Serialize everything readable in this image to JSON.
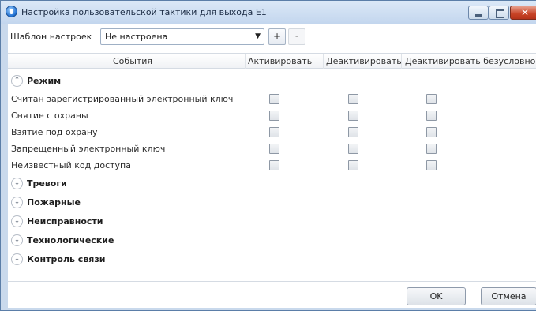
{
  "window": {
    "title": "Настройка пользовательской тактики для выхода E1"
  },
  "toolbar": {
    "template_label": "Шаблон настроек",
    "template_value": "Не настроена",
    "add_label": "+",
    "remove_label": "-"
  },
  "grid": {
    "columns": [
      "События",
      "Активировать",
      "Деактивировать",
      "Деактивировать безусловно"
    ],
    "groups": [
      {
        "label": "Режим",
        "expanded": true,
        "rows": [
          {
            "label": "Считан зарегистрированный электронный ключ",
            "activate": false,
            "deactivate": false,
            "deactivate_unconditional": false
          },
          {
            "label": "Снятие с охраны",
            "activate": false,
            "deactivate": false,
            "deactivate_unconditional": false
          },
          {
            "label": "Взятие под охрану",
            "activate": false,
            "deactivate": false,
            "deactivate_unconditional": false
          },
          {
            "label": "Запрещенный электронный ключ",
            "activate": false,
            "deactivate": false,
            "deactivate_unconditional": false
          },
          {
            "label": "Неизвестный код доступа",
            "activate": false,
            "deactivate": false,
            "deactivate_unconditional": false
          }
        ]
      },
      {
        "label": "Тревоги",
        "expanded": false
      },
      {
        "label": "Пожарные",
        "expanded": false
      },
      {
        "label": "Неисправности",
        "expanded": false
      },
      {
        "label": "Технологические",
        "expanded": false
      },
      {
        "label": "Контроль связи",
        "expanded": false
      }
    ]
  },
  "footer": {
    "ok_label": "OK",
    "cancel_label": "Отмена"
  },
  "colors": {
    "titlebar": "#c3d6ee",
    "close_button": "#c74326",
    "grid_border": "#d5dbe3"
  },
  "icons": {
    "window": "info-circle-icon",
    "expand": "chevron-down-icon",
    "collapse": "chevron-up-icon"
  }
}
